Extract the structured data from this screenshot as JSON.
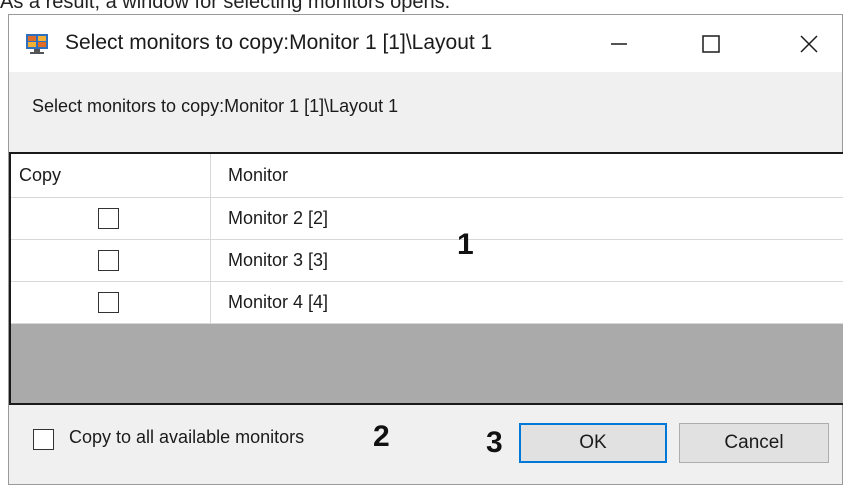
{
  "caption": "As a result, a window for selecting monitors opens.",
  "window": {
    "title": "Select monitors to copy:Monitor 1 [1]\\Layout 1",
    "icon": "monitor-grid-icon",
    "minimize_icon": "minimize-icon",
    "maximize_icon": "maximize-icon",
    "close_icon": "close-icon"
  },
  "header": {
    "label": "Select monitors to copy:Monitor 1 [1]\\Layout 1"
  },
  "grid": {
    "columns": [
      "Copy",
      "Monitor"
    ],
    "rows": [
      {
        "checked": false,
        "monitor": "Monitor 2 [2]"
      },
      {
        "checked": false,
        "monitor": "Monitor 3 [3]"
      },
      {
        "checked": false,
        "monitor": "Monitor 4 [4]"
      }
    ]
  },
  "footer": {
    "copy_all_label": "Copy to all available monitors",
    "copy_all_checked": false,
    "ok_label": "OK",
    "cancel_label": "Cancel"
  },
  "annotations": [
    "1",
    "2",
    "3"
  ],
  "colors": {
    "accent": "#0078d7",
    "empty_grid": "#aaaaaa",
    "dialog_bg": "#f0f0f0"
  }
}
